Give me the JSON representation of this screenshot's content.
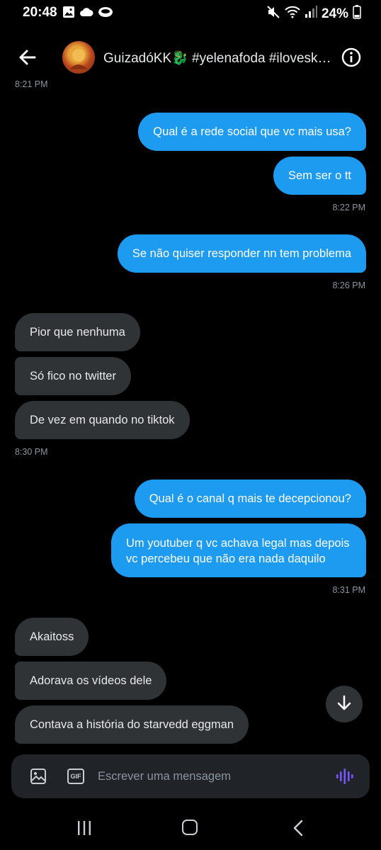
{
  "status_bar": {
    "time": "20:48",
    "battery": "24%",
    "left_icons": [
      "gallery-icon",
      "cloud-icon",
      "coin-icon"
    ],
    "right_icons": [
      "mute-icon",
      "wifi-icon",
      "signal-icon",
      "battery-icon"
    ]
  },
  "header": {
    "title": "GuizadóKK🐉 #yelenafoda #iloveskyl...",
    "avatar_alt": "avatar"
  },
  "messages": [
    {
      "id": "ts0",
      "kind": "timestamp",
      "side": "left",
      "text": "8:21 PM"
    },
    {
      "id": "m1",
      "kind": "bubble",
      "side": "out",
      "text": "Qual é a rede social que vc mais usa?"
    },
    {
      "id": "m2",
      "kind": "bubble",
      "side": "out",
      "text": "Sem ser o tt"
    },
    {
      "id": "ts1",
      "kind": "timestamp",
      "side": "right",
      "text": "8:22 PM"
    },
    {
      "id": "m3",
      "kind": "bubble",
      "side": "out",
      "text": "Se não quiser responder nn tem problema"
    },
    {
      "id": "ts2",
      "kind": "timestamp",
      "side": "right",
      "text": "8:26 PM"
    },
    {
      "id": "m4",
      "kind": "bubble",
      "side": "in",
      "text": "Pior que nenhuma"
    },
    {
      "id": "m5",
      "kind": "bubble",
      "side": "in",
      "text": "Só fico no twitter"
    },
    {
      "id": "m6",
      "kind": "bubble",
      "side": "in",
      "text": "De vez em quando no tiktok"
    },
    {
      "id": "ts3",
      "kind": "timestamp",
      "side": "left",
      "text": "8:30 PM"
    },
    {
      "id": "m7",
      "kind": "bubble",
      "side": "out",
      "text": "Qual é o canal q mais te decepcionou?"
    },
    {
      "id": "m8",
      "kind": "bubble",
      "side": "out",
      "text": "Um youtuber q vc achava legal mas depois vc percebeu que não era nada daquilo"
    },
    {
      "id": "ts4",
      "kind": "timestamp",
      "side": "right",
      "text": "8:31 PM"
    },
    {
      "id": "m9",
      "kind": "bubble",
      "side": "in",
      "text": "Akaitoss"
    },
    {
      "id": "m10",
      "kind": "bubble",
      "side": "in",
      "text": "Adorava os vídeos dele"
    },
    {
      "id": "m11",
      "kind": "bubble",
      "side": "in",
      "text": "Contava a história do starvedd eggman"
    }
  ],
  "composer": {
    "placeholder": "Escrever uma mensagem",
    "gif_label": "GIF"
  },
  "colors": {
    "outgoing_bubble": "#1d9bf0",
    "incoming_bubble": "#2f3336",
    "voice_accent": "#7856ff"
  }
}
